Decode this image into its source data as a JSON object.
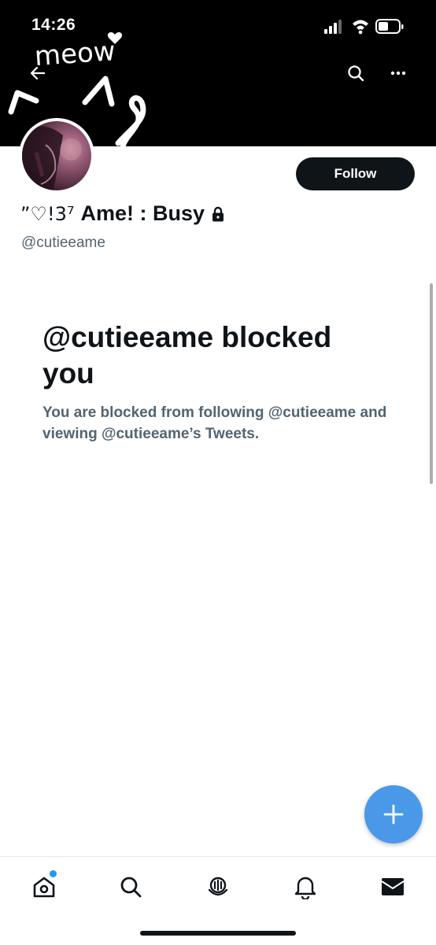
{
  "status_bar": {
    "time": "14:26"
  },
  "banner": {
    "doodle_text": "meow"
  },
  "profile": {
    "display_name_prefix": "”♡!3⁷",
    "display_name": "Ame! : Busy",
    "handle": "@cutieeame",
    "follow_label": "Follow"
  },
  "blocked": {
    "title": "@cutieeame blocked you",
    "description": "You are blocked from following @cutieeame and viewing @cutieeame’s Tweets."
  },
  "icons": {
    "back": "arrow-left-icon",
    "search": "search-icon",
    "more": "more-dots-icon",
    "lock": "lock-icon",
    "compose": "plus-icon",
    "tabs": [
      "home-icon",
      "search-icon",
      "spaces-icon",
      "bell-icon",
      "mail-icon"
    ]
  },
  "colors": {
    "banner": "#000000",
    "follow_button": "#0f1419",
    "fab": "#4a99e9",
    "secondary_text": "#536471",
    "notification_dot": "#1d9bf0"
  }
}
